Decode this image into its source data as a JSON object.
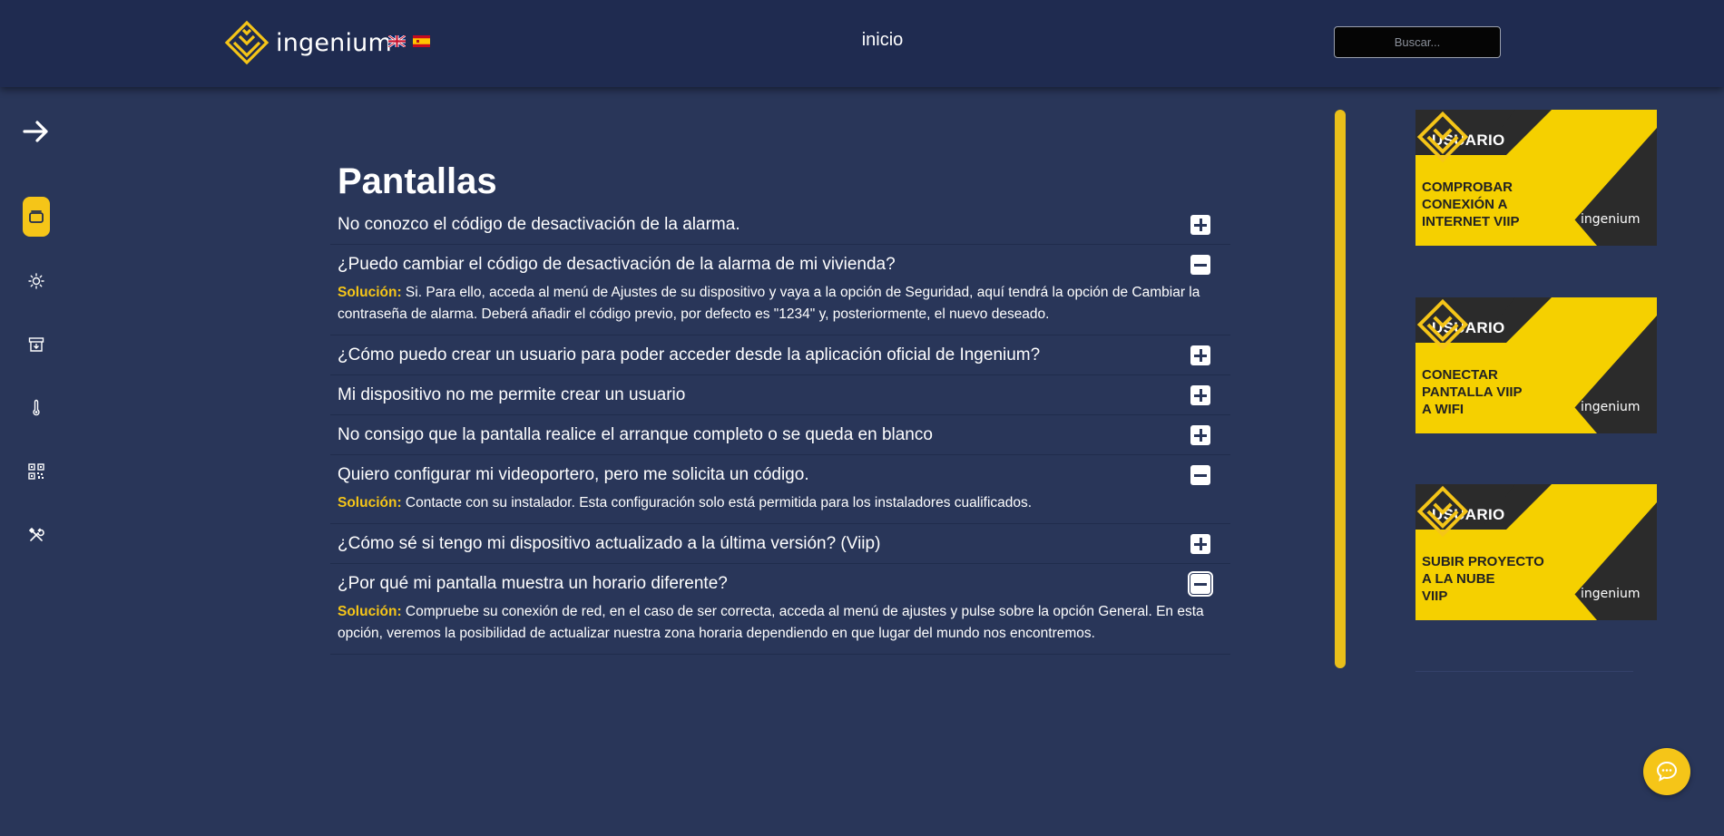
{
  "header": {
    "brand": "ingenium",
    "nav_link": "inicio",
    "search_placeholder": "Buscar...",
    "languages": [
      "en",
      "es"
    ]
  },
  "sidebar": {
    "toggle_icon": "arrow-right-icon",
    "items": [
      {
        "icon": "panel-icon",
        "active": true
      },
      {
        "icon": "sun-icon",
        "active": false
      },
      {
        "icon": "archive-icon",
        "active": false
      },
      {
        "icon": "thermometer-icon",
        "active": false
      },
      {
        "icon": "qr-code-icon",
        "active": false
      },
      {
        "icon": "tools-icon",
        "active": false
      }
    ]
  },
  "main": {
    "title": "Pantallas",
    "solution_label": "Solución:",
    "faqs": [
      {
        "question": "No conozco el código de desactivación de la alarma.",
        "expanded": false,
        "answer": ""
      },
      {
        "question": "¿Puedo cambiar el código de desactivación de la alarma de mi vivienda?",
        "expanded": true,
        "answer": "Si. Para ello, acceda al menú de Ajustes de su dispositivo y vaya a la opción de Seguridad, aquí tendrá la opción de Cambiar la contraseña de alarma. Deberá añadir el código previo, por defecto es \"1234\" y, posteriormente, el nuevo deseado."
      },
      {
        "question": "¿Cómo puedo crear un usuario para poder acceder desde la aplicación oficial de Ingenium?",
        "expanded": false,
        "answer": ""
      },
      {
        "question": "Mi dispositivo no me permite crear un usuario",
        "expanded": false,
        "answer": ""
      },
      {
        "question": "No consigo que la pantalla realice el arranque completo o se queda en blanco",
        "expanded": false,
        "answer": ""
      },
      {
        "question": "Quiero configurar mi videoportero, pero me solicita un código.",
        "expanded": true,
        "answer": "Contacte con su instalador. Esta configuración solo está permitida para los instaladores cualificados."
      },
      {
        "question": "¿Cómo sé si tengo mi dispositivo actualizado a la última versión? (Viip)",
        "expanded": false,
        "answer": ""
      },
      {
        "question": "¿Por qué mi pantalla muestra un horario diferente?",
        "expanded": true,
        "answer": "Compruebe su conexión de red, en el caso de ser correcta, acceda al menú de ajustes y pulse sobre la opción General. En esta opción, veremos la posibilidad de actualizar nuestra zona horaria dependiendo en que lugar del mundo nos encontremos."
      }
    ]
  },
  "banners": [
    {
      "label": "USUARIO",
      "lines": [
        "COMPROBAR",
        "CONEXIÓN A",
        "INTERNET VIIP"
      ],
      "brand": "ingenium"
    },
    {
      "label": "USUARIO",
      "lines": [
        "CONECTAR",
        "PANTALLA VIIP",
        "A WIFI"
      ],
      "brand": "ingenium"
    },
    {
      "label": "USUARIO",
      "lines": [
        "SUBIR PROYECTO",
        "A LA NUBE",
        "VIIP"
      ],
      "brand": "ingenium"
    }
  ],
  "colors": {
    "background": "#293659",
    "header": "#1f2b50",
    "accent": "#f5c518"
  },
  "chat": {
    "icon": "chat-bubble-icon"
  }
}
